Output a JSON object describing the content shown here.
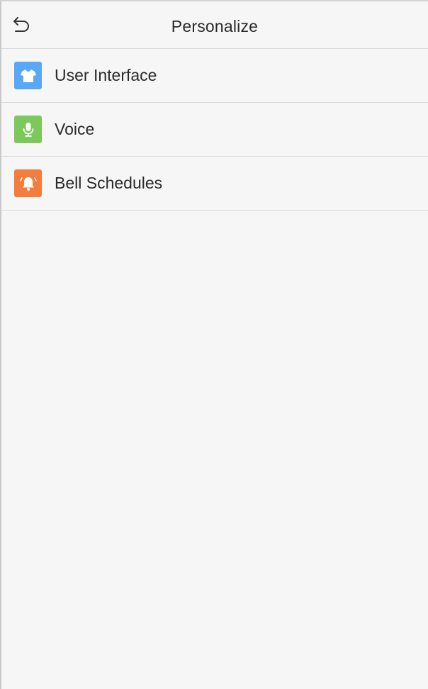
{
  "header": {
    "title": "Personalize",
    "back_icon": "back-arrow-icon"
  },
  "menu": {
    "items": [
      {
        "label": "User Interface",
        "icon": "tshirt-icon",
        "icon_color": "#5aa8f5"
      },
      {
        "label": "Voice",
        "icon": "microphone-icon",
        "icon_color": "#7cc85a"
      },
      {
        "label": "Bell Schedules",
        "icon": "bell-icon",
        "icon_color": "#f47c3c"
      }
    ]
  },
  "colors": {
    "background": "#f6f6f6",
    "divider": "#d9d9d9",
    "text": "#2a2a2a"
  }
}
